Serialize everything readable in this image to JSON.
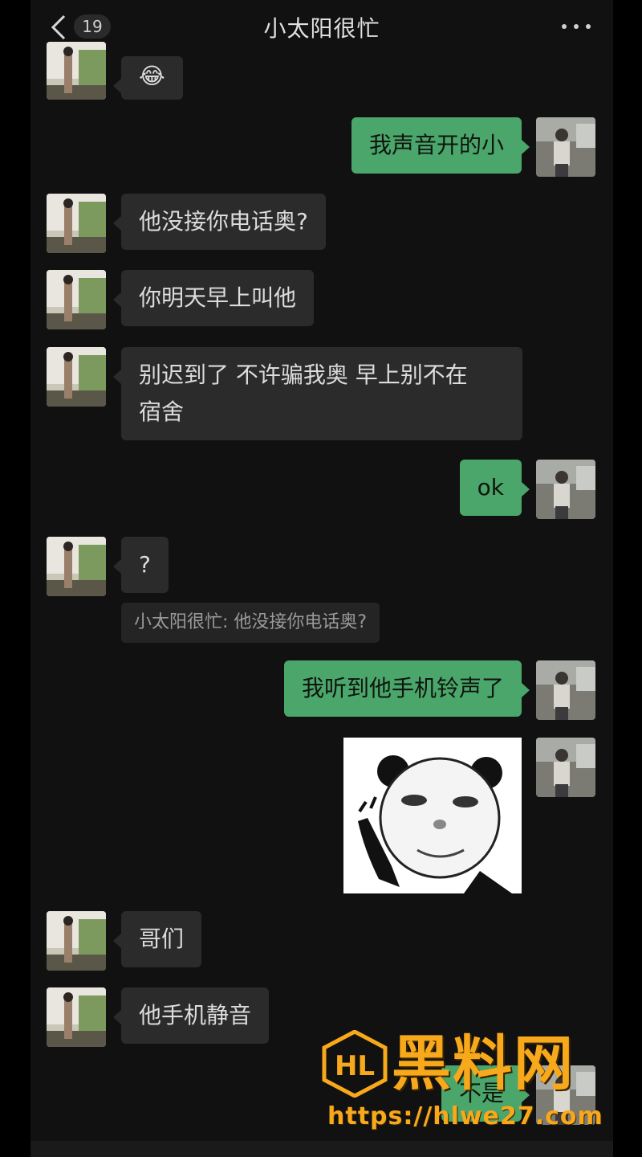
{
  "header": {
    "back_badge": "19",
    "title": "小太阳很忙"
  },
  "messages": [
    {
      "side": "in",
      "text": "😂"
    },
    {
      "side": "out",
      "text": "我声音开的小"
    },
    {
      "side": "in",
      "text": "他没接你电话奥?"
    },
    {
      "side": "in",
      "text": "你明天早上叫他"
    },
    {
      "side": "in",
      "text": "别迟到了 不许骗我奥 早上别不在\n宿舍"
    },
    {
      "side": "out",
      "text": "ok"
    },
    {
      "side": "in",
      "text": "?"
    },
    {
      "side": "quote",
      "text": "小太阳很忙: 他没接你电话奥?"
    },
    {
      "side": "out",
      "text": "我听到他手机铃声了"
    },
    {
      "side": "out",
      "type": "sticker",
      "text": ""
    },
    {
      "side": "in",
      "text": "哥们"
    },
    {
      "side": "in",
      "text": "他手机静音"
    },
    {
      "side": "out",
      "text": "不是"
    }
  ],
  "watermark": {
    "logo": "HL",
    "text": "黑料网",
    "url": "https://hlwe27.com"
  },
  "colors": {
    "background": "#111111",
    "incoming_bubble": "#2b2b2b",
    "outgoing_bubble": "#4aa66a",
    "watermark": "#f7a81b"
  }
}
